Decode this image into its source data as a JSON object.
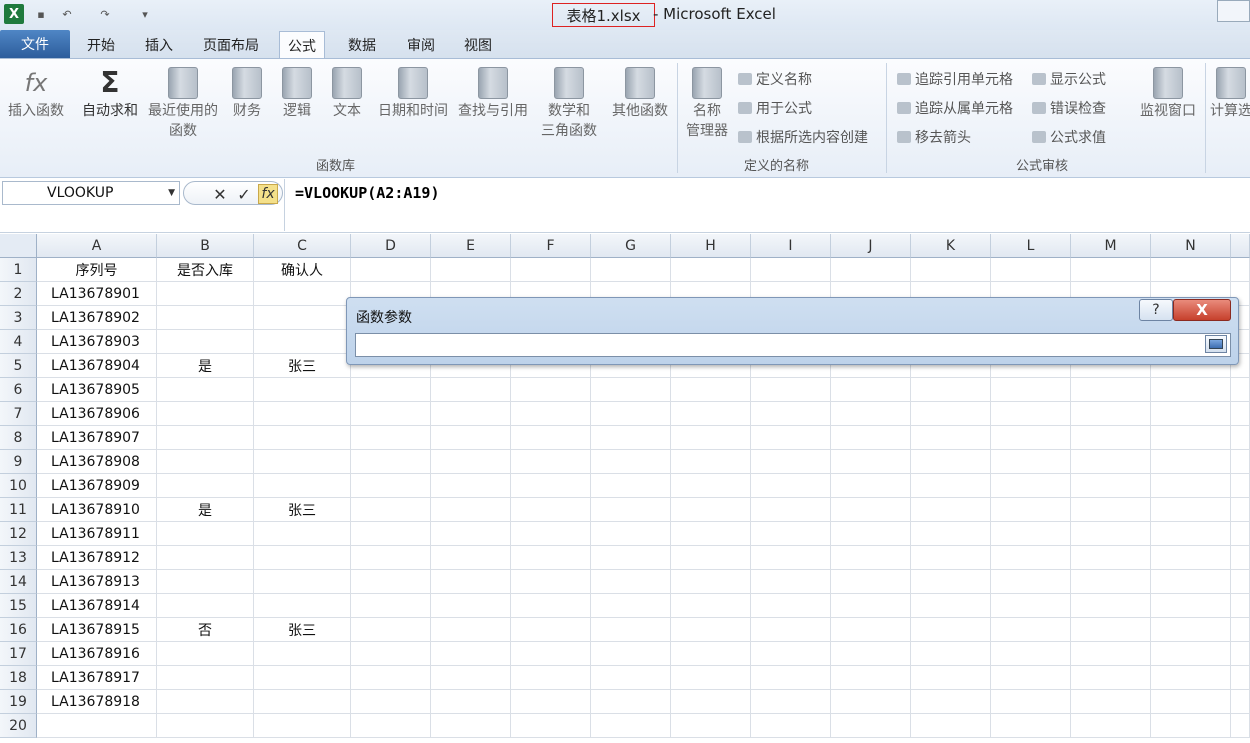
{
  "window": {
    "file_name": "表格1.xlsx",
    "app_name": "- Microsoft Excel"
  },
  "tabs": [
    "文件",
    "开始",
    "插入",
    "页面布局",
    "公式",
    "数据",
    "审阅",
    "视图"
  ],
  "ribbon": {
    "insert_function": "插入函数",
    "autosum": "自动求和",
    "recent_1": "最近使用的",
    "recent_2": "函数",
    "financial": "财务",
    "logical": "逻辑",
    "text": "文本",
    "datetime": "日期和时间",
    "lookup": "查找与引用",
    "math_1": "数学和",
    "math_2": "三角函数",
    "other": "其他函数",
    "group_library": "函数库",
    "name_manager_1": "名称",
    "name_manager_2": "管理器",
    "define_name": "定义名称",
    "use_in_formula": "用于公式",
    "create_from_selection": "根据所选内容创建",
    "group_defined_names": "定义的名称",
    "trace_precedents": "追踪引用单元格",
    "trace_dependents": "追踪从属单元格",
    "remove_arrows": "移去箭头",
    "show_formulas": "显示公式",
    "error_checking": "错误检查",
    "evaluate_formula": "公式求值",
    "group_auditing": "公式审核",
    "watch_window": "监视窗口",
    "calc_options": "计算选"
  },
  "formula_bar": {
    "name_box": "VLOOKUP",
    "fx": "fx",
    "formula": "=VLOOKUP(A2:A19)"
  },
  "columns": [
    "A",
    "B",
    "C",
    "D",
    "E",
    "F",
    "G",
    "H",
    "I",
    "J",
    "K",
    "L",
    "M",
    "N"
  ],
  "rows": [
    [
      "序列号",
      "是否入库",
      "确认人"
    ],
    [
      "LA13678901",
      "",
      ""
    ],
    [
      "LA13678902",
      "",
      ""
    ],
    [
      "LA13678903",
      "",
      ""
    ],
    [
      "LA13678904",
      "是",
      "张三"
    ],
    [
      "LA13678905",
      "",
      ""
    ],
    [
      "LA13678906",
      "",
      ""
    ],
    [
      "LA13678907",
      "",
      ""
    ],
    [
      "LA13678908",
      "",
      ""
    ],
    [
      "LA13678909",
      "",
      ""
    ],
    [
      "LA13678910",
      "是",
      "张三"
    ],
    [
      "LA13678911",
      "",
      ""
    ],
    [
      "LA13678912",
      "",
      ""
    ],
    [
      "LA13678913",
      "",
      ""
    ],
    [
      "LA13678914",
      "",
      ""
    ],
    [
      "LA13678915",
      "否",
      "张三"
    ],
    [
      "LA13678916",
      "",
      ""
    ],
    [
      "LA13678917",
      "",
      ""
    ],
    [
      "LA13678918",
      "",
      ""
    ],
    [
      "",
      "",
      ""
    ]
  ],
  "dialog": {
    "title": "函数参数",
    "help": "?",
    "close": "X",
    "input_value": ""
  }
}
